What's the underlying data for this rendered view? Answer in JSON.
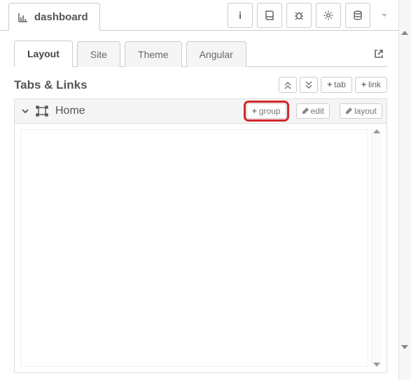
{
  "title": "dashboard",
  "toolbar_buttons": [
    "info",
    "book",
    "bug",
    "cog",
    "database"
  ],
  "tabs": [
    {
      "label": "Layout",
      "active": true
    },
    {
      "label": "Site",
      "active": false
    },
    {
      "label": "Theme",
      "active": false
    },
    {
      "label": "Angular",
      "active": false
    }
  ],
  "section_title": "Tabs & Links",
  "section_buttons": {
    "collapse_all": "«",
    "expand_all": "»",
    "add_tab": "tab",
    "add_link": "link"
  },
  "home": {
    "name": "Home",
    "buttons": {
      "group": "group",
      "edit": "edit",
      "layout": "layout"
    }
  }
}
